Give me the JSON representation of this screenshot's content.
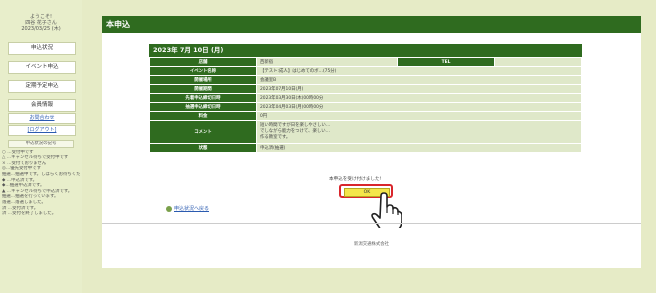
{
  "sidebar": {
    "welcome": [
      "ようこそ!",
      "四谷 花子さん",
      "2023/03/25 (木)"
    ],
    "menu": [
      {
        "label": "申込状況"
      },
      {
        "label": "イベント申込"
      },
      {
        "label": "定期予定申込"
      },
      {
        "label": "会員情報"
      }
    ],
    "links": [
      "お問合わせ",
      "[ログアウト]"
    ],
    "legend": {
      "title": "申込状況の記号",
      "items": [
        "○ …受付中です",
        "△ …キャンセル待ちで受付中です",
        "× …受付ておりません",
        "◎…優先受付中です",
        "抽選…抽選中です。しばらくお待ちください",
        "◆ …申込済です。",
        "◆…抽選申込済です。",
        "▲ …キャンセル待ちで申込済です。",
        "抽選…抽選を行っています。",
        "落選…落選しました。",
        "済 …受付済です。",
        "済 …受付を終了しました。"
      ]
    }
  },
  "main": {
    "title": "本申込",
    "panel_title": "2023年 7月 10日 (月)",
    "rows": [
      {
        "label": "店舗",
        "value": "西新宿"
      },
      {
        "label": "イベント名称",
        "value": "【テスト:成人】はじめてのボ…(75分)"
      },
      {
        "label": "開催場所",
        "value": "会議室B"
      },
      {
        "label": "開催期間",
        "value": "2023年07月10日(月)"
      },
      {
        "label": "先着申込締切日時",
        "value": "2023年03月30日(木)00時00分"
      },
      {
        "label": "抽選申込締切日時",
        "value": "2023年04月03日(月)00時00分"
      },
      {
        "label": "料金",
        "value": "0円"
      },
      {
        "label": "コメント",
        "value": "短い時間ですが日を楽しやさしい…\nでしながら能力をつけて、楽しい…\n作る教室です。"
      },
      {
        "label": "状態",
        "value": "申込済(抽選)"
      }
    ],
    "tel_label": "TEL",
    "tel_value": "",
    "confirm_text": "本申込を受け付けました!",
    "ok_label": "OK",
    "back_link": "申込状況へ戻る",
    "footer": "新潟交通株式会社"
  }
}
